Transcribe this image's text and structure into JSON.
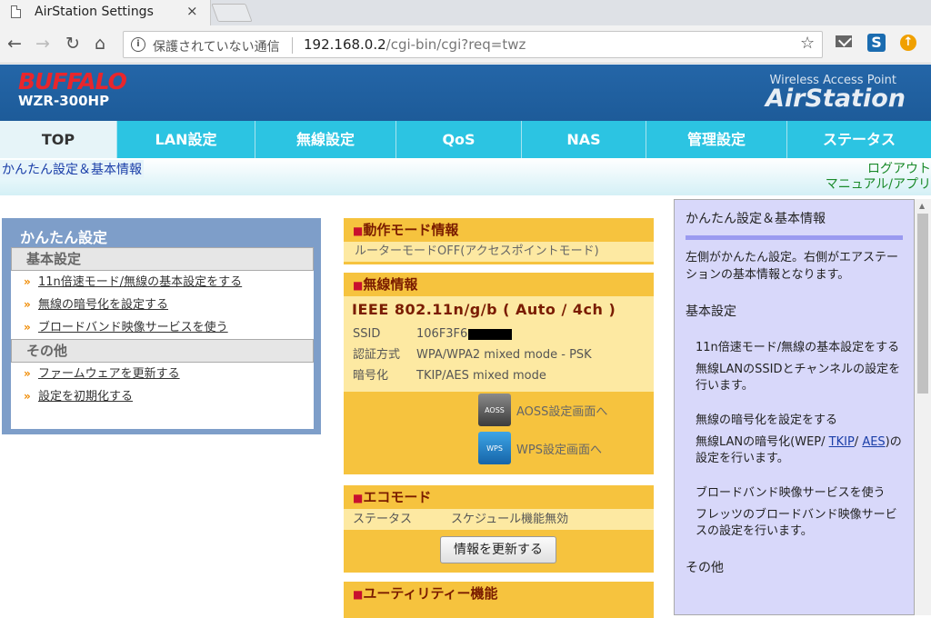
{
  "browser": {
    "tab_title": "AirStation Settings",
    "tab_close": "×",
    "security_label": "保護されていない通信",
    "url_host": "192.168.0.2",
    "url_path": "/cgi-bin/cgi?req=twz",
    "back": "←",
    "forward": "→",
    "reload": "↻",
    "home": "⌂",
    "star": "☆",
    "ext_s": "S",
    "ext_up": "↑"
  },
  "header": {
    "brand": "BUFFALO",
    "model": "WZR-300HP",
    "tagline": "Wireless Access Point",
    "product": "AirStation"
  },
  "menu": {
    "items": [
      "TOP",
      "LAN設定",
      "無線設定",
      "QoS",
      "NAS",
      "管理設定",
      "ステータス"
    ]
  },
  "submenu": {
    "crumb": "かんたん設定＆基本情報",
    "logout": "ログアウト",
    "manual": "マニュアル/アプリ"
  },
  "quick": {
    "title": "かんたん設定",
    "basic_heading": "基本設定",
    "basic_links": [
      "11n倍速モード/無線の基本設定をする",
      "無線の暗号化を設定する",
      "ブロードバンド映像サービスを使う"
    ],
    "other_heading": "その他",
    "other_links": [
      "ファームウェアを更新する",
      "設定を初期化する"
    ]
  },
  "mode": {
    "title": "動作モード情報",
    "value": "ルーターモードOFF(アクセスポイントモード)"
  },
  "wireless": {
    "title": "無線情報",
    "standard": "IEEE 802.11n/g/b ( Auto / 4ch )",
    "ssid_label": "SSID",
    "ssid_value": "106F3F6",
    "auth_label": "認証方式",
    "auth_value": "WPA/WPA2 mixed mode - PSK",
    "enc_label": "暗号化",
    "enc_value": "TKIP/AES mixed mode",
    "aoss_icon_text": "AOSS",
    "aoss_label": "AOSS設定画面へ",
    "wps_icon_text": "WPS",
    "wps_label": "WPS設定画面へ"
  },
  "eco": {
    "title": "エコモード",
    "status_label": "ステータス",
    "status_value": "スケジュール機能無効",
    "update_button": "情報を更新する"
  },
  "utility": {
    "title": "ユーティリティー機能"
  },
  "help": {
    "title": "かんたん設定＆基本情報",
    "intro": "左側がかんたん設定。右側がエアステーションの基本情報となります。",
    "basic_heading": "基本設定",
    "items": [
      {
        "title": "11n倍速モード/無線の基本設定をする",
        "desc": "無線LANのSSIDとチャンネルの設定を行います。"
      },
      {
        "title": "無線の暗号化を設定をする",
        "desc_pre": "無線LANの暗号化(WEP/ ",
        "link1": "TKIP",
        "desc_mid": "/ ",
        "link2": "AES",
        "desc_post": ")の設定を行います。"
      },
      {
        "title": "ブロードバンド映像サービスを使う",
        "desc": "フレッツのブロードバンド映像サービスの設定を行います。"
      }
    ],
    "other_heading": "その他"
  }
}
